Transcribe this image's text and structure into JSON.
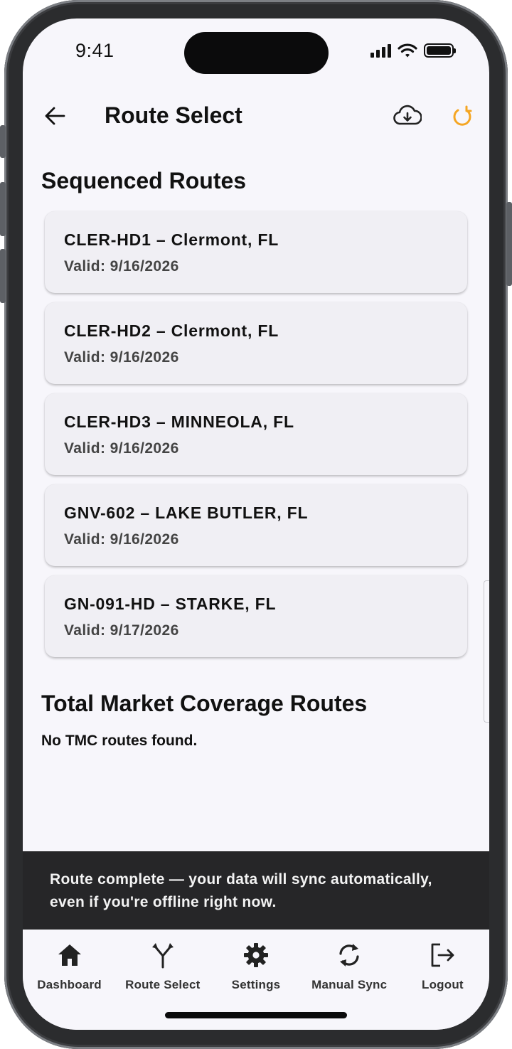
{
  "status_bar": {
    "time": "9:41"
  },
  "header": {
    "title": "Route Select"
  },
  "accent_color": "#F5A623",
  "sections": {
    "sequenced_title": "Sequenced Routes",
    "tmc_title": "Total Market Coverage Routes",
    "tmc_empty": "No TMC routes found."
  },
  "routes": [
    {
      "name": "CLER-HD1 – Clermont, FL",
      "valid": "Valid: 9/16/2026"
    },
    {
      "name": "CLER-HD2 – Clermont, FL",
      "valid": "Valid: 9/16/2026"
    },
    {
      "name": "CLER-HD3 – MINNEOLA, FL",
      "valid": "Valid: 9/16/2026"
    },
    {
      "name": "GNV-602 – LAKE BUTLER, FL",
      "valid": "Valid: 9/16/2026"
    },
    {
      "name": "GN-091-HD – STARKE, FL",
      "valid": "Valid: 9/17/2026"
    }
  ],
  "snackbar": {
    "line1": "Route complete — your data will sync automatically,",
    "line2": "even if you're offline right now."
  },
  "nav": [
    {
      "label": "Dashboard",
      "icon": "home-icon"
    },
    {
      "label": "Route Select",
      "icon": "route-fork-icon"
    },
    {
      "label": "Settings",
      "icon": "gear-icon"
    },
    {
      "label": "Manual Sync",
      "icon": "sync-icon"
    },
    {
      "label": "Logout",
      "icon": "logout-icon"
    }
  ]
}
